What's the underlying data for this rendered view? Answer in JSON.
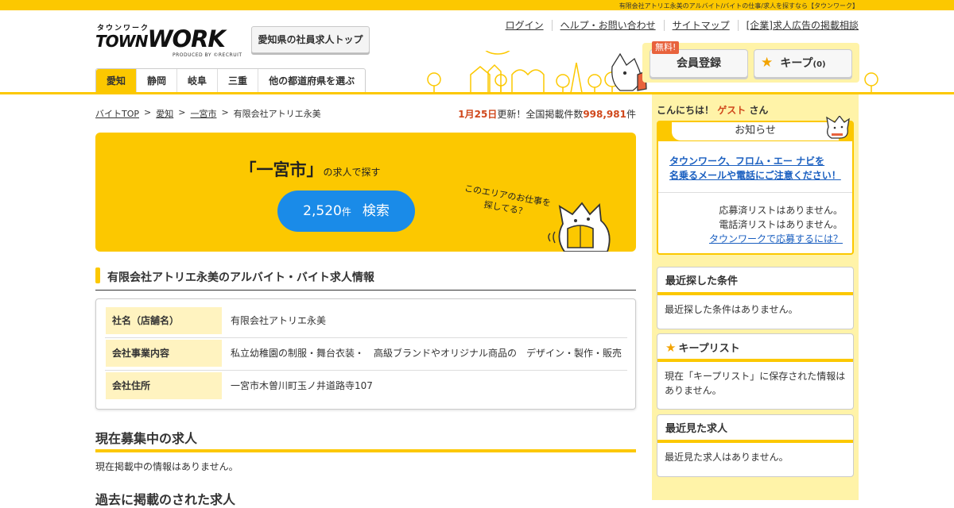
{
  "top_band_text": "有限会社アトリエ永美のアルバイト/バイトの仕事/求人を探すなら【タウンワーク】",
  "logo": {
    "kana": "タウンワーク",
    "word_town": "TOWN",
    "word_work": "WORK",
    "produced": "PRODUCED BY ©RECRUIT"
  },
  "pref_top_button": "愛知県の社員求人トップ",
  "top_links": [
    "ログイン",
    "ヘルプ・お問い合わせ",
    "サイトマップ",
    "[企業]求人広告の掲載相談"
  ],
  "member": {
    "free_badge": "無料!",
    "register": "会員登録",
    "keep": "キープ",
    "keep_count": "(0)"
  },
  "nav_tabs": [
    "愛知",
    "静岡",
    "岐阜",
    "三重",
    "他の都道府県を選ぶ"
  ],
  "breadcrumb": {
    "items": [
      "バイトTOP",
      "愛知",
      "一宮市"
    ],
    "current": "有限会社アトリエ永美",
    "sep": ">"
  },
  "updated": {
    "date": "1月25日",
    "text": "更新！全国掲載件数",
    "count": "998,981",
    "unit": "件"
  },
  "hero": {
    "city": "「一宮市」",
    "suffix": "の求人で探す",
    "count": "2,520",
    "unit": "件",
    "search": "検索",
    "bubble_line1": "このエリアのお仕事を",
    "bubble_line2": "探してる？"
  },
  "section_title": "有限会社アトリエ永美のアルバイト・バイト求人情報",
  "company": {
    "rows": [
      {
        "label": "社名（店舗名）",
        "value": "有限会社アトリエ永美"
      },
      {
        "label": "会社事業内容",
        "value": "私立幼稚園の制服・舞台衣装・　高級ブランドやオリジナル商品の　デザイン・製作・販売"
      },
      {
        "label": "会社住所",
        "value": "一宮市木曽川町玉ノ井道路寺107"
      }
    ]
  },
  "current_jobs": {
    "title": "現在募集中の求人",
    "empty": "現在掲載中の情報はありません。"
  },
  "past_jobs": {
    "title": "過去に掲載のされた求人"
  },
  "sidebar": {
    "hello": "こんにちは！",
    "guest": "ゲスト",
    "san": "さん",
    "notice": {
      "title": "お知らせ",
      "link_line1": "タウンワーク、フロム・エー ナビを",
      "link_line2": "名乗るメールや電話にご注意ください！",
      "applied": "応募済リストはありません。",
      "called": "電話済リストはありません。",
      "howto": "タウンワークで応募するには？"
    },
    "recent_search": {
      "title": "最近探した条件",
      "body": "最近探した条件はありません。"
    },
    "keep_list": {
      "title": "キープリスト",
      "body": "現在「キープリスト」に保存された情報はありません。"
    },
    "recent_viewed": {
      "title": "最近見た求人",
      "body": "最近見た求人はありません。"
    }
  },
  "colors": {
    "brand_yellow": "#fcc800",
    "search_blue": "#1a8be8",
    "link_blue": "#1a5fc0",
    "accent_red": "#d0481c",
    "sidebar_bg": "#fff3a8"
  }
}
